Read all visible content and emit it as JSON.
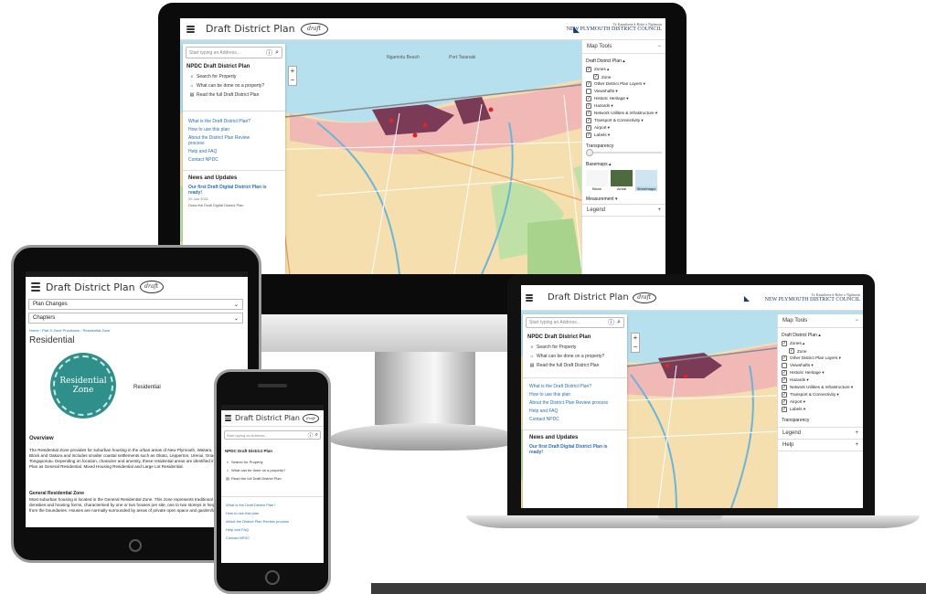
{
  "app": {
    "title": "Draft District Plan",
    "badge_label": "draft",
    "council_line1": "Te Kaunihera-ā-Rohe o Ngāmotu",
    "council_line2": "NEW PLYMOUTH DISTRICT COUNCIL"
  },
  "search": {
    "placeholder": "Start typing an Address..."
  },
  "panel": {
    "title": "NPDC Draft District Plan",
    "items": [
      {
        "label": "Search for Property",
        "icon": "search-icon"
      },
      {
        "label": "What can be done on a property?",
        "icon": "home-icon"
      },
      {
        "label": "Read the full Draft District Plan",
        "icon": "document-icon"
      }
    ],
    "links": [
      "What is the Draft District Plan?",
      "How to use this plan",
      "About the District Plan Review process",
      "Help and FAQ",
      "Contact NPDC"
    ],
    "news_title": "News and Updates",
    "news_item": "Our first Draft Digital District Plan is ready!",
    "news_date": "20 Jan 2021",
    "news_item2": "Draw the Draft Digital District Plan"
  },
  "map_tools": {
    "title": "Map Tools",
    "section": "Draft District Plan ▴",
    "layers": [
      {
        "label": "Zones ▴",
        "checked": true,
        "indent": 0
      },
      {
        "label": "Zone",
        "checked": true,
        "indent": 1
      },
      {
        "label": "Other District Plan Layers ▾",
        "checked": true,
        "indent": 0
      },
      {
        "label": "Viewshafts ▾",
        "checked": false,
        "indent": 0
      },
      {
        "label": "Historic Heritage ▾",
        "checked": true,
        "indent": 0
      },
      {
        "label": "Hazards ▾",
        "checked": true,
        "indent": 0
      },
      {
        "label": "Network Utilities & Infrastructure ▾",
        "checked": true,
        "indent": 0
      },
      {
        "label": "Transport & Connectivity ▾",
        "checked": true,
        "indent": 0
      },
      {
        "label": "Airport ▾",
        "checked": true,
        "indent": 0
      },
      {
        "label": "Labels ▾",
        "checked": true,
        "indent": 0
      }
    ],
    "transparency": "Transparency",
    "basemaps": "Basemaps ▴",
    "basemap_options": [
      "Blank",
      "Aerial",
      "Streetmaps"
    ],
    "measurement": "Measurement ▾",
    "legend": "Legend",
    "help": "Help"
  },
  "tablet": {
    "dropdown1": "Plan Changes",
    "dropdown2": "Chapters",
    "crumb1": "Home",
    "crumb2": "Part D Zone Provisions",
    "crumb3": "Residential Zone",
    "heading": "Residential",
    "circle_line1": "Residential",
    "circle_line2": "Zone",
    "side_label": "Residential",
    "overview_title": "Overview",
    "overview_text": "The Residential Zone provides for suburban housing in the urban areas of New Plymouth, Waitara, Inglewood, Bell Block and Oakura and includes smaller coastal settlements such as Okato, Lepperton, Urenui, Onaero and Tongaporutu. Depending on location, character and amenity, these residential areas are identified in the District Plan as General Residential, Mixed Housing Residential and Large Lot Residential.",
    "general_title": "General Residential Zone",
    "general_text": "Most suburban housing is located in the General Residential Zone. This zone represents traditional suburban densities and housing forms, characterised by one or two houses per site, one to two storeys in height and set back from the boundaries. Houses are normally surrounded by areas of private open space and garden/landscaping."
  },
  "map_labels": [
    "Ngamotu Beach",
    "Port Taranaki"
  ]
}
